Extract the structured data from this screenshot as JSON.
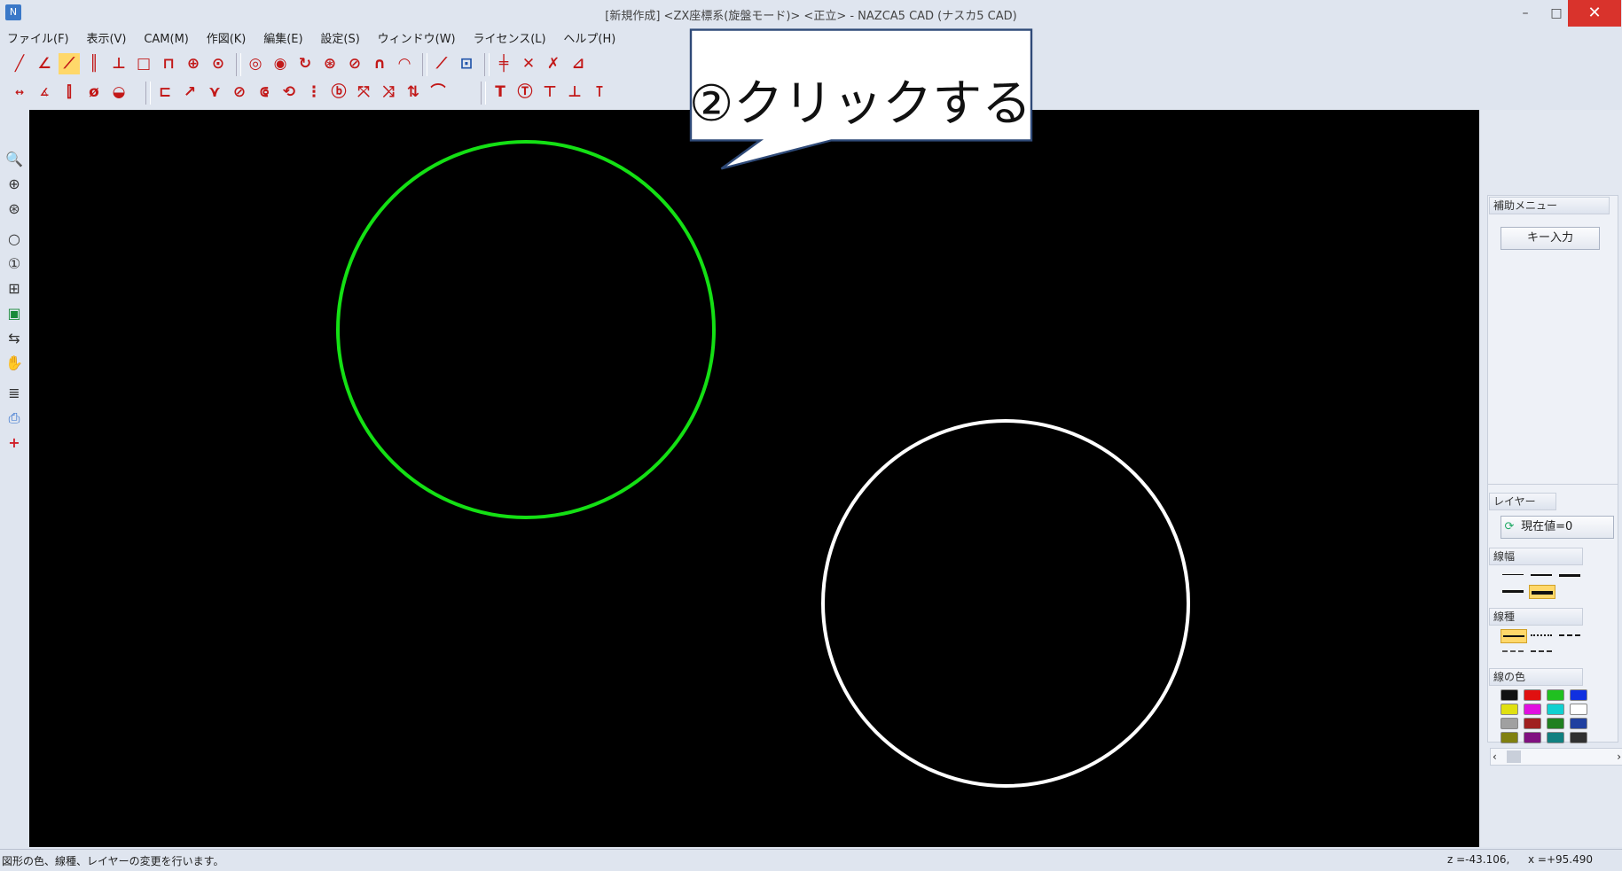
{
  "window": {
    "title": "[新規作成] <ZX座標系(旋盤モード)> <正立> - NAZCA5 CAD (ナスカ5 CAD)",
    "app_icon": "app-icon",
    "controls": {
      "minimize": "–",
      "maximize": "□",
      "close": "✕"
    }
  },
  "menu": {
    "items": [
      "ファイル(F)",
      "表示(V)",
      "CAM(M)",
      "作図(K)",
      "編集(E)",
      "設定(S)",
      "ウィンドウ(W)",
      "ライセンス(L)",
      "ヘルプ(H)"
    ]
  },
  "toolbar1": {
    "icons": [
      "line-icon",
      "angle-line-icon",
      "tangent-line-icon",
      "parallel-lines-icon",
      "perpendicular-icon",
      "rectangle-icon",
      "polyline-icon",
      "center-circle-icon",
      "circle-icon",
      "arc-icon",
      "tangent-arc-icon",
      "rotate-arc-icon",
      "tangent-circle-icon",
      "reverse-arc-icon",
      "ellipse-icon",
      "fillet-icon",
      "point-icon",
      "snap-grid-icon",
      "trim-icon",
      "cross-delete-icon",
      "extend-icon",
      "measure-icon"
    ]
  },
  "toolbar2": {
    "icons": [
      "dimension-icon",
      "angle-dimension-icon",
      "hole-dimension-icon",
      "diameter-dimension-icon",
      "radius-dimension-icon",
      "chamfer-icon",
      "leader-icon",
      "branch-icon",
      "null-icon",
      "offset-icon",
      "spiral-icon",
      "pattern-icon",
      "node-icon",
      "xy-icon",
      "sort-icon",
      "curve-icon",
      "text-t-icon",
      "text-bold-icon",
      "text-left-icon",
      "text-under-icon",
      "text-center-icon"
    ]
  },
  "left_tools": {
    "icons": [
      "zoom-in-icon",
      "zoom-previous-icon",
      "zoom-window-icon",
      "zoom-fit-icon",
      "zoom-one-icon",
      "center-view-icon",
      "redraw-icon",
      "swap-icon",
      "pan-hand-icon",
      "layer-stack-icon",
      "printer-icon",
      "plus-cursor-icon"
    ]
  },
  "callout": {
    "text": "②クリックする"
  },
  "canvas": {
    "background": "#000000",
    "circles": [
      {
        "name": "green-circle",
        "color": "#14e014",
        "selected": true
      },
      {
        "name": "white-circle",
        "color": "#ffffff",
        "selected": false
      }
    ]
  },
  "right_panel": {
    "aux_menu_title": "補助メニュー",
    "key_input_label": "キー入力",
    "layer_title": "レイヤー",
    "layer_current_label": "現在値=0",
    "line_width_title": "線幅",
    "line_type_title": "線種",
    "line_color_title": "線の色",
    "colors": [
      "#111111",
      "#e01010",
      "#20c020",
      "#1030e0",
      "#e0e010",
      "#e010e0",
      "#10d0d0",
      "#ffffff",
      "#a0a0a0",
      "#a02020",
      "#208020",
      "#2040a0",
      "#808010",
      "#801080",
      "#108080",
      "#303030"
    ]
  },
  "statusbar": {
    "message": "図形の色、線種、レイヤーの変更を行います。",
    "z_readout": "z =-43.106,",
    "x_readout": "x =+95.490"
  }
}
